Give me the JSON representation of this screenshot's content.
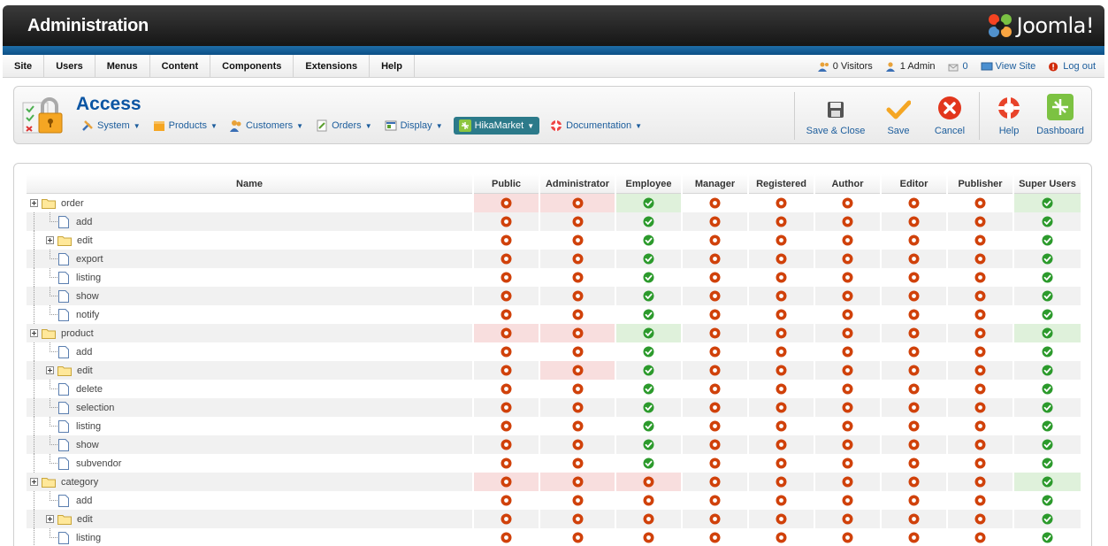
{
  "header": {
    "title": "Administration",
    "logo_text": "Joomla!"
  },
  "menu": {
    "items": [
      "Site",
      "Users",
      "Menus",
      "Content",
      "Components",
      "Extensions",
      "Help"
    ]
  },
  "status": {
    "visitors": "0 Visitors",
    "admins": "1 Admin",
    "messages": "0",
    "view_site": "View Site",
    "logout": "Log out"
  },
  "page": {
    "title": "Access"
  },
  "submenu": [
    {
      "label": "System",
      "icon": "tools-icon",
      "active": false
    },
    {
      "label": "Products",
      "icon": "box-icon",
      "active": false
    },
    {
      "label": "Customers",
      "icon": "users-icon",
      "active": false
    },
    {
      "label": "Orders",
      "icon": "orders-icon",
      "active": false
    },
    {
      "label": "Display",
      "icon": "display-icon",
      "active": false
    },
    {
      "label": "HikaMarket",
      "icon": "hikamarket-icon",
      "active": true
    },
    {
      "label": "Documentation",
      "icon": "lifebuoy-icon",
      "active": false
    }
  ],
  "toolbar": {
    "save_close": "Save & Close",
    "save": "Save",
    "cancel": "Cancel",
    "help": "Help",
    "dashboard": "Dashboard"
  },
  "colors": {
    "allowed": "#2c9a2c",
    "denied": "#d0410a",
    "highlight_denied": "#f8dede",
    "highlight_allowed": "#dff1db"
  },
  "table": {
    "columns": [
      "Name",
      "Public",
      "Administrator",
      "Employee",
      "Manager",
      "Registered",
      "Author",
      "Editor",
      "Publisher",
      "Super Users"
    ],
    "rows": [
      {
        "name": "order",
        "level": 0,
        "type": "folder",
        "expandable": true,
        "values": [
          "n",
          "n",
          "y",
          "n",
          "n",
          "n",
          "n",
          "n",
          "y"
        ],
        "hl": [
          "r",
          "r",
          "g",
          "",
          "",
          "",
          "",
          "",
          "g"
        ]
      },
      {
        "name": "add",
        "level": 1,
        "type": "doc",
        "expandable": false,
        "values": [
          "n",
          "n",
          "y",
          "n",
          "n",
          "n",
          "n",
          "n",
          "y"
        ],
        "hl": [
          "",
          "",
          "",
          "",
          "",
          "",
          "",
          "",
          ""
        ]
      },
      {
        "name": "edit",
        "level": 1,
        "type": "folder",
        "expandable": true,
        "values": [
          "n",
          "n",
          "y",
          "n",
          "n",
          "n",
          "n",
          "n",
          "y"
        ],
        "hl": [
          "",
          "",
          "",
          "",
          "",
          "",
          "",
          "",
          ""
        ]
      },
      {
        "name": "export",
        "level": 1,
        "type": "doc",
        "expandable": false,
        "values": [
          "n",
          "n",
          "y",
          "n",
          "n",
          "n",
          "n",
          "n",
          "y"
        ],
        "hl": [
          "",
          "",
          "",
          "",
          "",
          "",
          "",
          "",
          ""
        ]
      },
      {
        "name": "listing",
        "level": 1,
        "type": "doc",
        "expandable": false,
        "values": [
          "n",
          "n",
          "y",
          "n",
          "n",
          "n",
          "n",
          "n",
          "y"
        ],
        "hl": [
          "",
          "",
          "",
          "",
          "",
          "",
          "",
          "",
          ""
        ]
      },
      {
        "name": "show",
        "level": 1,
        "type": "doc",
        "expandable": false,
        "values": [
          "n",
          "n",
          "y",
          "n",
          "n",
          "n",
          "n",
          "n",
          "y"
        ],
        "hl": [
          "",
          "",
          "",
          "",
          "",
          "",
          "",
          "",
          ""
        ]
      },
      {
        "name": "notify",
        "level": 1,
        "type": "doc",
        "expandable": false,
        "values": [
          "n",
          "n",
          "y",
          "n",
          "n",
          "n",
          "n",
          "n",
          "y"
        ],
        "hl": [
          "",
          "",
          "",
          "",
          "",
          "",
          "",
          "",
          ""
        ]
      },
      {
        "name": "product",
        "level": 0,
        "type": "folder",
        "expandable": true,
        "values": [
          "n",
          "n",
          "y",
          "n",
          "n",
          "n",
          "n",
          "n",
          "y"
        ],
        "hl": [
          "r",
          "r",
          "g",
          "",
          "",
          "",
          "",
          "",
          "g"
        ]
      },
      {
        "name": "add",
        "level": 1,
        "type": "doc",
        "expandable": false,
        "values": [
          "n",
          "n",
          "y",
          "n",
          "n",
          "n",
          "n",
          "n",
          "y"
        ],
        "hl": [
          "",
          "",
          "",
          "",
          "",
          "",
          "",
          "",
          ""
        ]
      },
      {
        "name": "edit",
        "level": 1,
        "type": "folder",
        "expandable": true,
        "values": [
          "n",
          "n",
          "y",
          "n",
          "n",
          "n",
          "n",
          "n",
          "y"
        ],
        "hl": [
          "",
          "r",
          "",
          "",
          "",
          "",
          "",
          "",
          ""
        ]
      },
      {
        "name": "delete",
        "level": 1,
        "type": "doc",
        "expandable": false,
        "values": [
          "n",
          "n",
          "y",
          "n",
          "n",
          "n",
          "n",
          "n",
          "y"
        ],
        "hl": [
          "",
          "",
          "",
          "",
          "",
          "",
          "",
          "",
          ""
        ]
      },
      {
        "name": "selection",
        "level": 1,
        "type": "doc",
        "expandable": false,
        "values": [
          "n",
          "n",
          "y",
          "n",
          "n",
          "n",
          "n",
          "n",
          "y"
        ],
        "hl": [
          "",
          "",
          "",
          "",
          "",
          "",
          "",
          "",
          ""
        ]
      },
      {
        "name": "listing",
        "level": 1,
        "type": "doc",
        "expandable": false,
        "values": [
          "n",
          "n",
          "y",
          "n",
          "n",
          "n",
          "n",
          "n",
          "y"
        ],
        "hl": [
          "",
          "",
          "",
          "",
          "",
          "",
          "",
          "",
          ""
        ]
      },
      {
        "name": "show",
        "level": 1,
        "type": "doc",
        "expandable": false,
        "values": [
          "n",
          "n",
          "y",
          "n",
          "n",
          "n",
          "n",
          "n",
          "y"
        ],
        "hl": [
          "",
          "",
          "",
          "",
          "",
          "",
          "",
          "",
          ""
        ]
      },
      {
        "name": "subvendor",
        "level": 1,
        "type": "doc",
        "expandable": false,
        "values": [
          "n",
          "n",
          "y",
          "n",
          "n",
          "n",
          "n",
          "n",
          "y"
        ],
        "hl": [
          "",
          "",
          "",
          "",
          "",
          "",
          "",
          "",
          ""
        ]
      },
      {
        "name": "category",
        "level": 0,
        "type": "folder",
        "expandable": true,
        "values": [
          "n",
          "n",
          "n",
          "n",
          "n",
          "n",
          "n",
          "n",
          "y"
        ],
        "hl": [
          "r",
          "r",
          "r",
          "",
          "",
          "",
          "",
          "",
          "g"
        ]
      },
      {
        "name": "add",
        "level": 1,
        "type": "doc",
        "expandable": false,
        "values": [
          "n",
          "n",
          "n",
          "n",
          "n",
          "n",
          "n",
          "n",
          "y"
        ],
        "hl": [
          "",
          "",
          "",
          "",
          "",
          "",
          "",
          "",
          ""
        ]
      },
      {
        "name": "edit",
        "level": 1,
        "type": "folder",
        "expandable": true,
        "values": [
          "n",
          "n",
          "n",
          "n",
          "n",
          "n",
          "n",
          "n",
          "y"
        ],
        "hl": [
          "",
          "",
          "",
          "",
          "",
          "",
          "",
          "",
          ""
        ]
      },
      {
        "name": "listing",
        "level": 1,
        "type": "doc",
        "expandable": false,
        "values": [
          "n",
          "n",
          "n",
          "n",
          "n",
          "n",
          "n",
          "n",
          "y"
        ],
        "hl": [
          "",
          "",
          "",
          "",
          "",
          "",
          "",
          "",
          ""
        ]
      }
    ]
  }
}
